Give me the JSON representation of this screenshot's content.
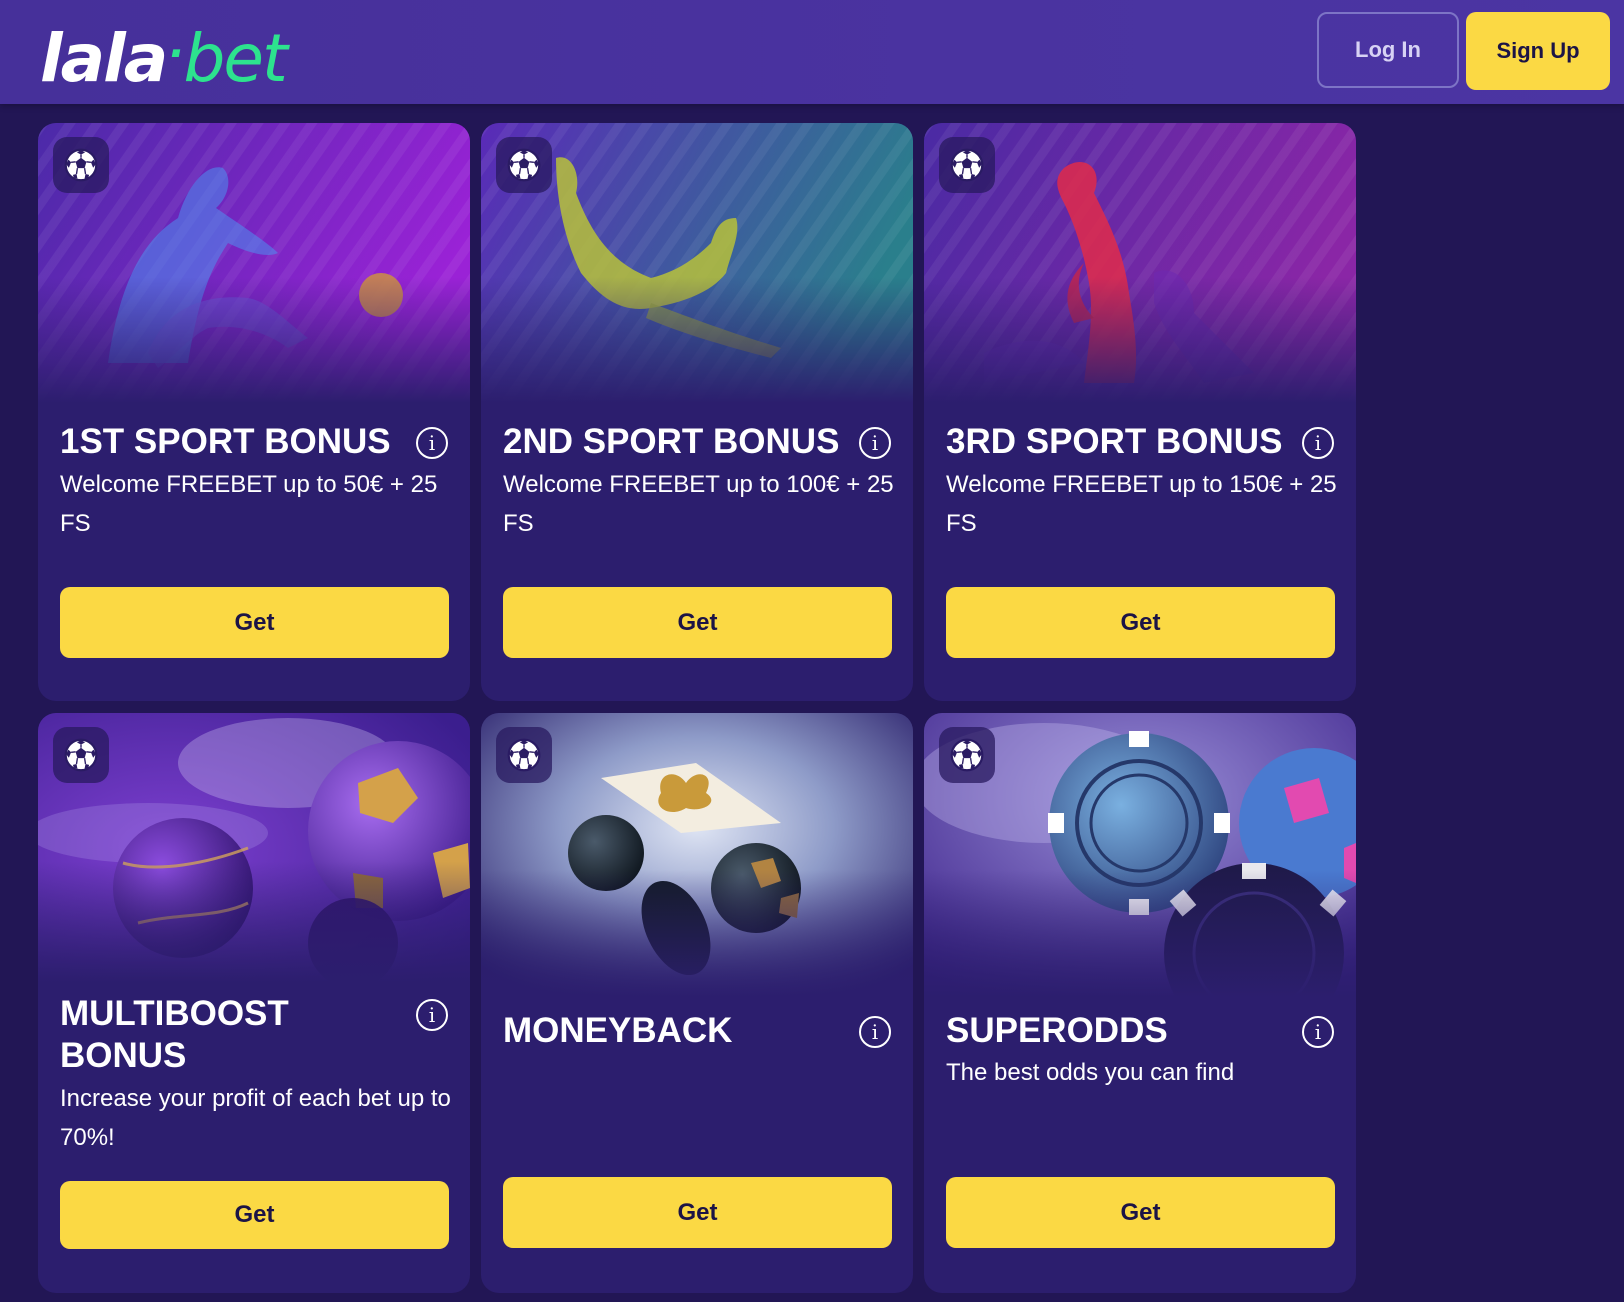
{
  "header": {
    "logo_left": "lala",
    "logo_dot": "·",
    "logo_right": "bet",
    "login_label": "Log In",
    "signup_label": "Sign Up"
  },
  "colors": {
    "accent_yellow": "#fbd944",
    "logo_green": "#2de28e",
    "header_purple": "#4a33a0",
    "card_purple": "#2c1e6e",
    "page_background": "#221655"
  },
  "cards": [
    {
      "title": "1ST SPORT BONUS",
      "description": "Welcome FREEBET up to 50€ + 25 FS",
      "button_label": "Get",
      "badge_icon": "soccer-ball-icon",
      "info_icon": "info-icon"
    },
    {
      "title": "2ND SPORT BONUS",
      "description": "Welcome FREEBET up to 100€ + 25 FS",
      "button_label": "Get",
      "badge_icon": "soccer-ball-icon",
      "info_icon": "info-icon"
    },
    {
      "title": "3RD SPORT BONUS",
      "description": "Welcome FREEBET up to 150€ + 25 FS",
      "button_label": "Get",
      "badge_icon": "soccer-ball-icon",
      "info_icon": "info-icon"
    },
    {
      "title": "MULTIBOOST BONUS",
      "description": "Increase your profit of each bet up to 70%!",
      "button_label": "Get",
      "badge_icon": "soccer-ball-icon",
      "info_icon": "info-icon"
    },
    {
      "title": "MONEYBACK",
      "description": "",
      "button_label": "Get",
      "badge_icon": "soccer-ball-icon",
      "info_icon": "info-icon"
    },
    {
      "title": "SUPERODDS",
      "description": "The best odds you can find",
      "button_label": "Get",
      "badge_icon": "soccer-ball-icon",
      "info_icon": "info-icon"
    }
  ]
}
